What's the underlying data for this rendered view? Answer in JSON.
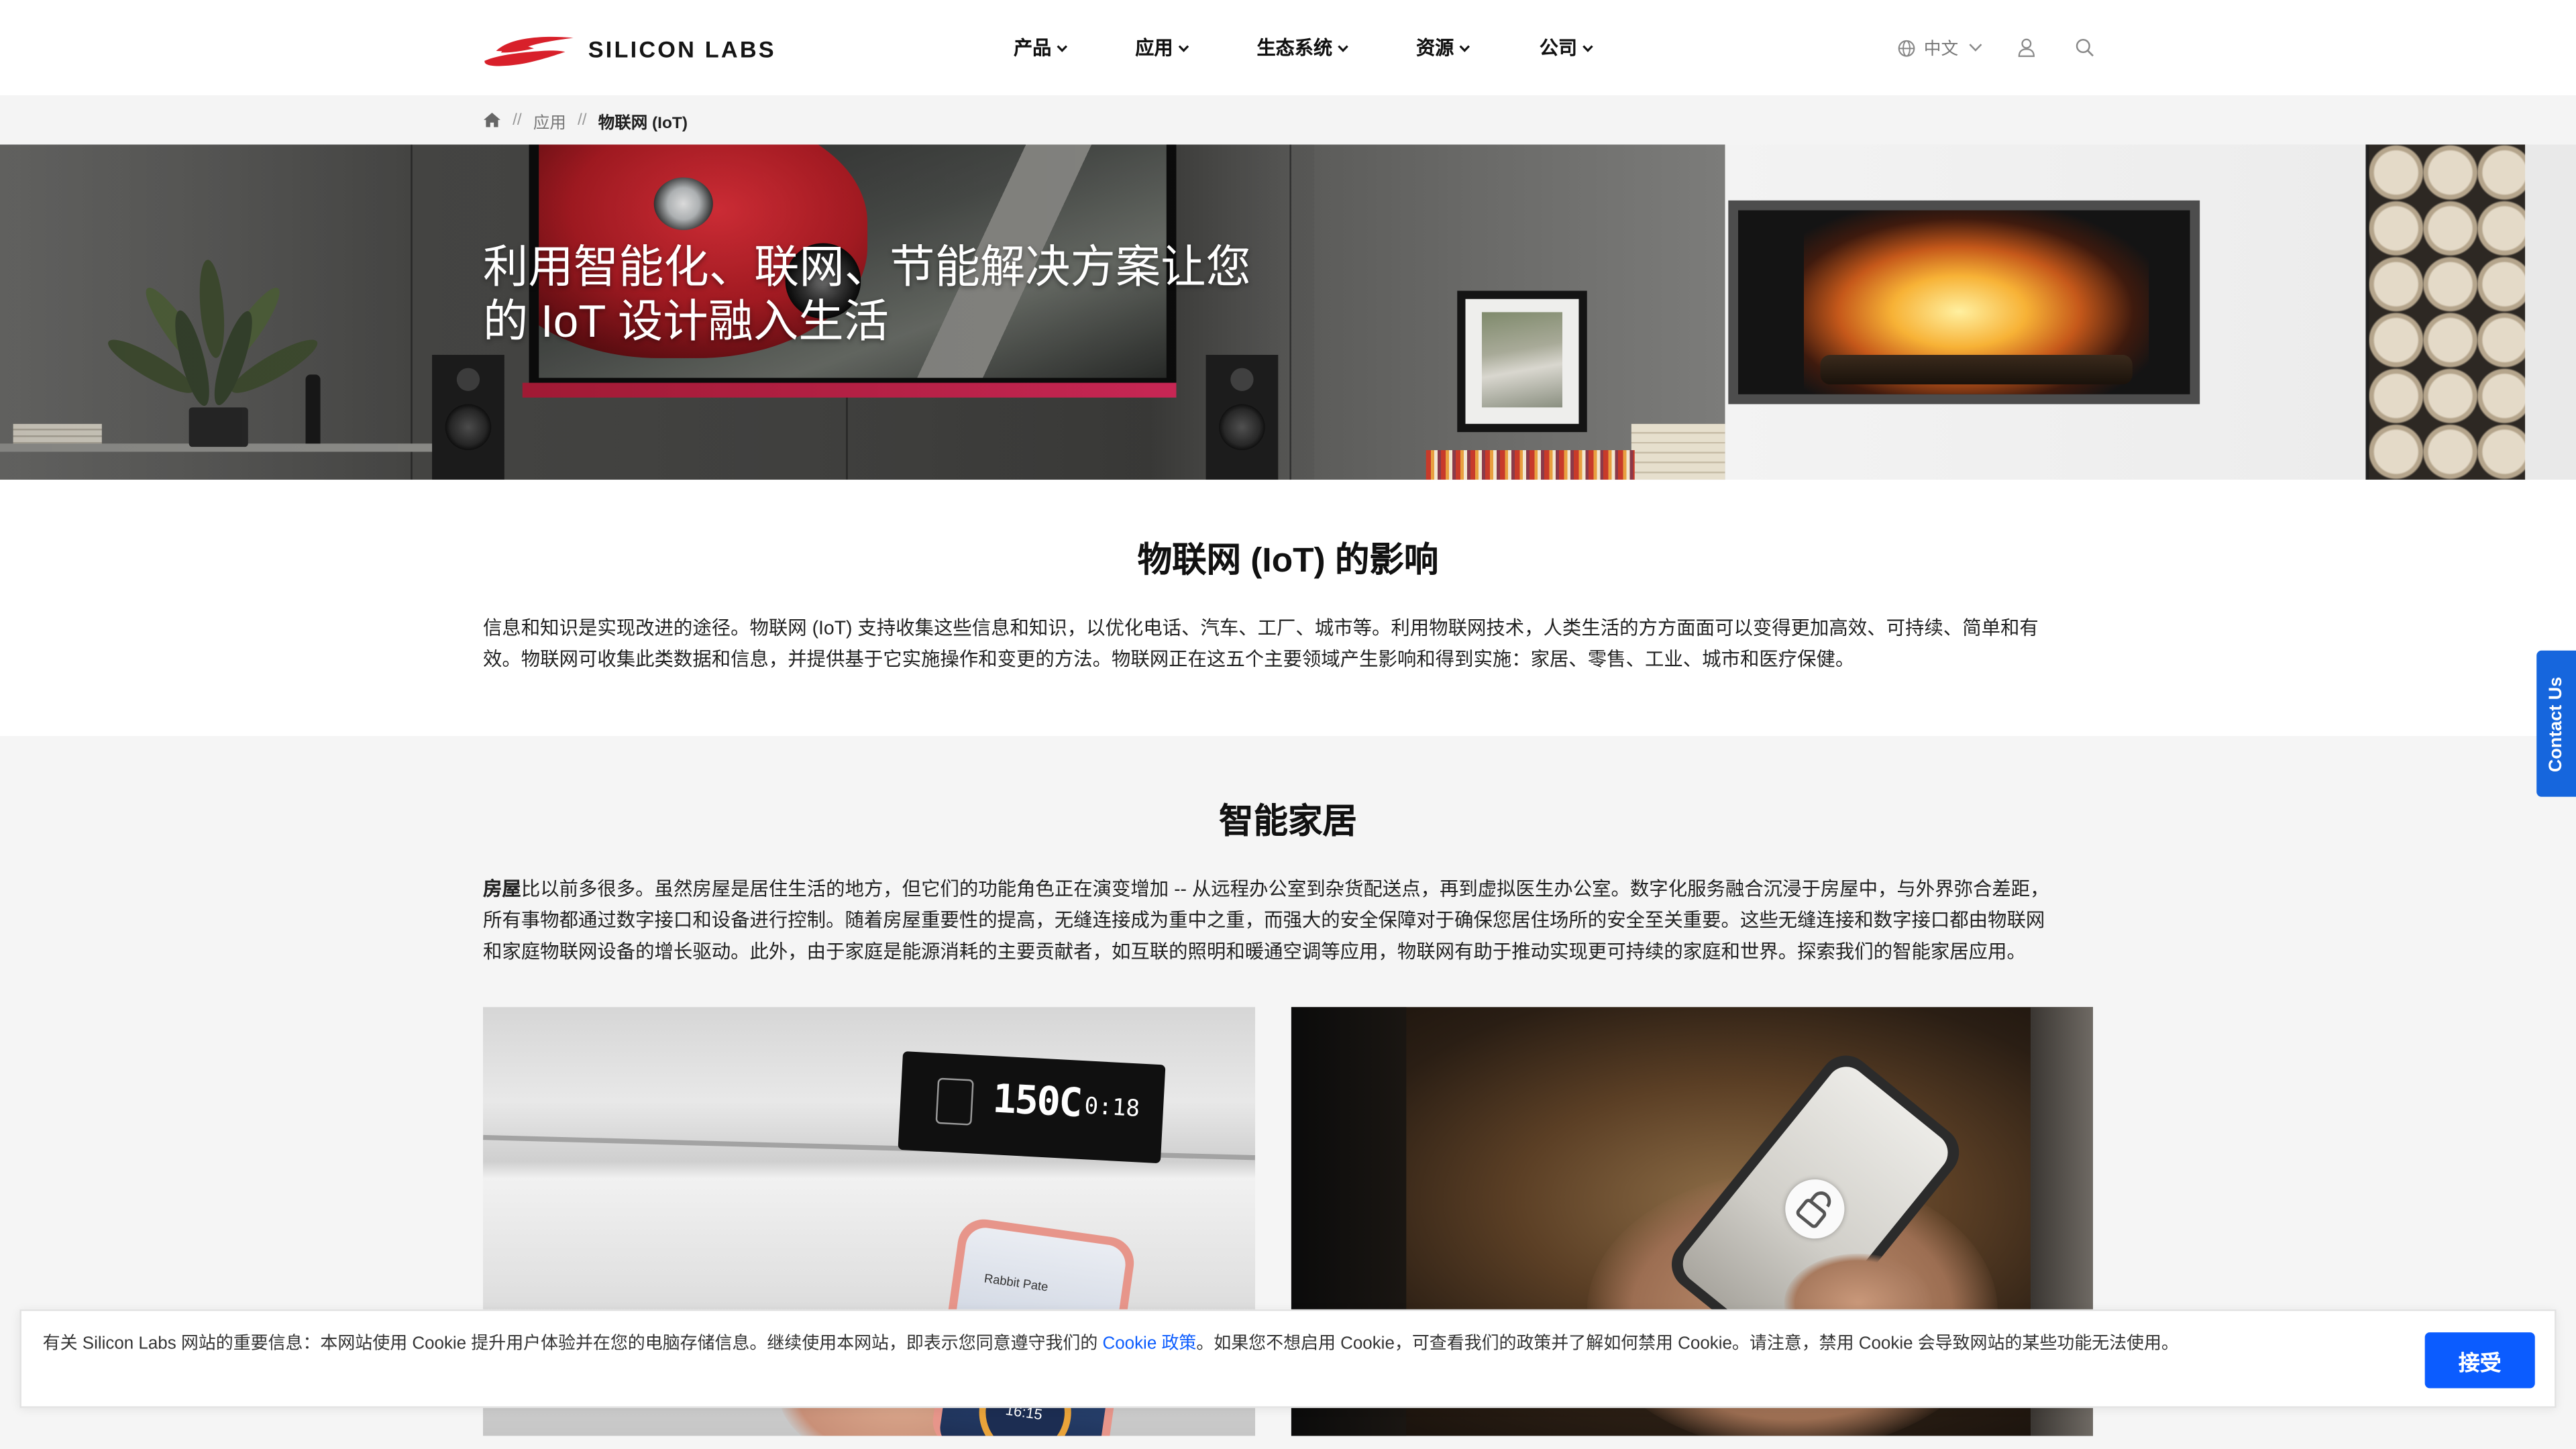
{
  "colors": {
    "brand_red": "#d8202a",
    "accent_blue": "#0b5cff",
    "contact_blue": "#1666dd",
    "text": "#1a1a1a",
    "muted": "#777777",
    "section_bg": "#f5f5f5"
  },
  "header": {
    "logo_text": "SILICON LABS",
    "logo_icon": "silicon-labs-swoosh-icon"
  },
  "nav": {
    "items": [
      {
        "label": "产品"
      },
      {
        "label": "应用"
      },
      {
        "label": "生态系统"
      },
      {
        "label": "资源"
      },
      {
        "label": "公司"
      }
    ]
  },
  "utility": {
    "language": "中文",
    "icons": [
      "globe-icon",
      "chevron-down-icon",
      "user-icon",
      "search-icon"
    ]
  },
  "breadcrumb": {
    "home_icon": "home-icon",
    "separator": "//",
    "items": [
      {
        "label": "应用"
      },
      {
        "label": "物联网 (IoT)"
      }
    ]
  },
  "hero": {
    "title": "利用智能化、联网、节能解决方案让您的 IoT 设计融入生活"
  },
  "impact": {
    "title": "物联网 (IoT) 的影响",
    "body": "信息和知识是实现改进的途径。物联网 (IoT) 支持收集这些信息和知识，以优化电话、汽车、工厂、城市等。利用物联网技术，人类生活的方方面面可以变得更加高效、可持续、简单和有效。物联网可收集此类数据和信息，并提供基于它实施操作和变更的方法。物联网正在这五个主要领域产生影响和得到实施：家居、零售、工业、城市和医疗保健。"
  },
  "smart_home": {
    "title": "智能家居",
    "lead": "房屋",
    "body": "比以前多很多。虽然房屋是居住生活的地方，但它们的功能角色正在演变增加 -- 从远程办公室到杂货配送点，再到虚拟医生办公室。数字化服务融合沉浸于房屋中，与外界弥合差距，所有事物都通过数字接口和设备进行控制。随着房屋重要性的提高，无缝连接成为重中之重，而强大的安全保障对于确保您居住场所的安全至关重要。这些无缝连接和数字接口都由物联网和家庭物联网设备的增长驱动。此外，由于家庭是能源消耗的主要贡献者，如互联的照明和暖通空调等应用，物联网有助于推动实现更可持续的家庭和世界。探索我们的智能家居应用。",
    "cards": [
      {
        "display_temp": "150C",
        "display_time": "0:18",
        "phone_title": "Rabbit Pate",
        "phone_time": "16:15"
      },
      {
        "icon": "unlock-icon"
      }
    ]
  },
  "contact_tab": {
    "label": "Contact Us"
  },
  "cookie": {
    "text_before": "有关 Silicon Labs 网站的重要信息：本网站使用 Cookie 提升用户体验并在您的电脑存储信息。继续使用本网站，即表示您同意遵守我们的 ",
    "link": "Cookie 政策",
    "text_after": "。如果您不想启用 Cookie，可查看我们的政策并了解如何禁用 Cookie。请注意，禁用 Cookie 会导致网站的某些功能无法使用。",
    "accept_label": "接受"
  }
}
